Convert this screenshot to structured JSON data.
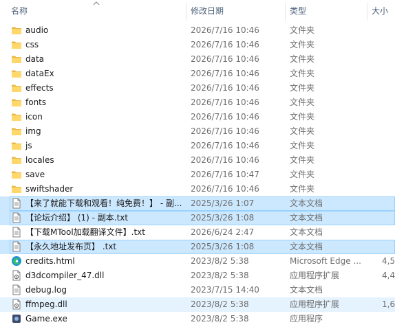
{
  "columns": {
    "name": "名称",
    "date": "修改日期",
    "type": "类型",
    "size": "大小"
  },
  "files": [
    {
      "name": "audio",
      "date": "2026/7/16 10:46",
      "type": "文件夹",
      "size": "",
      "icon": "folder-icon",
      "state": ""
    },
    {
      "name": "css",
      "date": "2026/7/16 10:46",
      "type": "文件夹",
      "size": "",
      "icon": "folder-icon",
      "state": ""
    },
    {
      "name": "data",
      "date": "2026/7/16 10:46",
      "type": "文件夹",
      "size": "",
      "icon": "folder-icon",
      "state": ""
    },
    {
      "name": "dataEx",
      "date": "2026/7/16 10:46",
      "type": "文件夹",
      "size": "",
      "icon": "folder-icon",
      "state": ""
    },
    {
      "name": "effects",
      "date": "2026/7/16 10:46",
      "type": "文件夹",
      "size": "",
      "icon": "folder-icon",
      "state": ""
    },
    {
      "name": "fonts",
      "date": "2026/7/16 10:46",
      "type": "文件夹",
      "size": "",
      "icon": "folder-icon",
      "state": ""
    },
    {
      "name": "icon",
      "date": "2026/7/16 10:46",
      "type": "文件夹",
      "size": "",
      "icon": "folder-icon",
      "state": ""
    },
    {
      "name": "img",
      "date": "2026/7/16 10:46",
      "type": "文件夹",
      "size": "",
      "icon": "folder-icon",
      "state": ""
    },
    {
      "name": "js",
      "date": "2026/7/16 10:46",
      "type": "文件夹",
      "size": "",
      "icon": "folder-icon",
      "state": ""
    },
    {
      "name": "locales",
      "date": "2026/7/16 10:46",
      "type": "文件夹",
      "size": "",
      "icon": "folder-icon",
      "state": ""
    },
    {
      "name": "save",
      "date": "2026/7/16 10:47",
      "type": "文件夹",
      "size": "",
      "icon": "folder-icon",
      "state": ""
    },
    {
      "name": "swiftshader",
      "date": "2026/7/16 10:46",
      "type": "文件夹",
      "size": "",
      "icon": "folder-icon",
      "state": ""
    },
    {
      "name": "【来了就能下载和观看！纯免费！】 - 副...",
      "date": "2025/3/26 1:07",
      "type": "文本文档",
      "size": "",
      "icon": "text-file-icon",
      "state": "selected"
    },
    {
      "name": "【论坛介绍】 (1) - 副本.txt",
      "date": "2025/3/26 1:08",
      "type": "文本文档",
      "size": "",
      "icon": "text-file-icon",
      "state": "selected"
    },
    {
      "name": "【下载MTool加载翻译文件】.txt",
      "date": "2026/6/24 2:47",
      "type": "文本文档",
      "size": "",
      "icon": "text-file-icon",
      "state": ""
    },
    {
      "name": "【永久地址发布页】 .txt",
      "date": "2025/3/26 1:08",
      "type": "文本文档",
      "size": "",
      "icon": "text-file-icon",
      "state": "selected"
    },
    {
      "name": "credits.html",
      "date": "2023/8/2 5:38",
      "type": "Microsoft Edge ...",
      "size": "4,5",
      "icon": "edge-icon",
      "state": ""
    },
    {
      "name": "d3dcompiler_47.dll",
      "date": "2023/8/2 5:38",
      "type": "应用程序扩展",
      "size": "4,4",
      "icon": "dll-file-icon",
      "state": ""
    },
    {
      "name": "debug.log",
      "date": "2023/7/15 14:40",
      "type": "文本文档",
      "size": "",
      "icon": "text-file-icon",
      "state": ""
    },
    {
      "name": "ffmpeg.dll",
      "date": "2023/8/2 5:38",
      "type": "应用程序扩展",
      "size": "1,6",
      "icon": "dll-file-icon",
      "state": "hover"
    },
    {
      "name": "Game.exe",
      "date": "2023/8/2 5:38",
      "type": "应用程序",
      "size": "",
      "icon": "game-exe-icon",
      "state": ""
    }
  ]
}
